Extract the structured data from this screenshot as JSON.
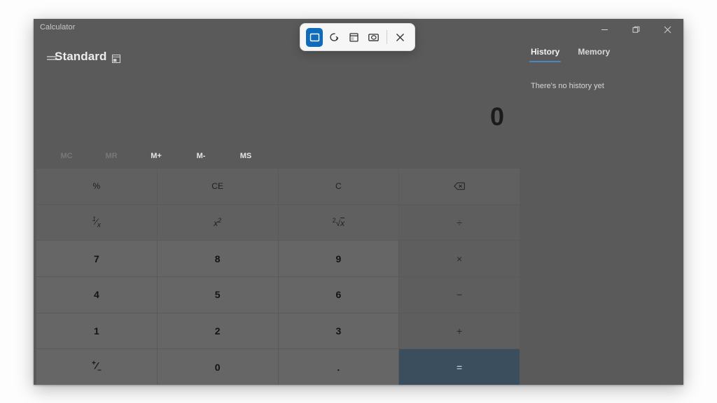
{
  "window": {
    "app_title": "Calculator",
    "controls": {
      "minimize": "minimize-icon",
      "restore": "restore-icon",
      "close": "close-icon"
    }
  },
  "header": {
    "menu_icon": "hamburger-menu-icon",
    "mode": "Standard",
    "keep_on_top_icon": "keep-on-top-icon"
  },
  "display": {
    "expression": "",
    "result": "0"
  },
  "memory": {
    "buttons": [
      {
        "label": "MC",
        "enabled": false
      },
      {
        "label": "MR",
        "enabled": false
      },
      {
        "label": "M+",
        "enabled": true
      },
      {
        "label": "M-",
        "enabled": true
      },
      {
        "label": "MS",
        "enabled": true
      }
    ]
  },
  "keypad": {
    "keys": [
      {
        "label": "%",
        "kind": "func",
        "name": "percent-button"
      },
      {
        "label": "CE",
        "kind": "func",
        "name": "clear-entry-button"
      },
      {
        "label": "C",
        "kind": "func",
        "name": "clear-button"
      },
      {
        "label": "",
        "kind": "func",
        "name": "backspace-button",
        "icon": "backspace-icon"
      },
      {
        "label": "",
        "kind": "func",
        "name": "reciprocal-button",
        "glyph": "reciprocal"
      },
      {
        "label": "",
        "kind": "func",
        "name": "square-button",
        "glyph": "square"
      },
      {
        "label": "",
        "kind": "func",
        "name": "square-root-button",
        "glyph": "sqrt"
      },
      {
        "label": "÷",
        "kind": "op",
        "name": "divide-button"
      },
      {
        "label": "7",
        "kind": "num",
        "name": "digit-7-button"
      },
      {
        "label": "8",
        "kind": "num",
        "name": "digit-8-button"
      },
      {
        "label": "9",
        "kind": "num",
        "name": "digit-9-button"
      },
      {
        "label": "×",
        "kind": "op",
        "name": "multiply-button"
      },
      {
        "label": "4",
        "kind": "num",
        "name": "digit-4-button"
      },
      {
        "label": "5",
        "kind": "num",
        "name": "digit-5-button"
      },
      {
        "label": "6",
        "kind": "num",
        "name": "digit-6-button"
      },
      {
        "label": "−",
        "kind": "op",
        "name": "subtract-button"
      },
      {
        "label": "1",
        "kind": "num",
        "name": "digit-1-button"
      },
      {
        "label": "2",
        "kind": "num",
        "name": "digit-2-button"
      },
      {
        "label": "3",
        "kind": "num",
        "name": "digit-3-button"
      },
      {
        "label": "+",
        "kind": "op",
        "name": "add-button"
      },
      {
        "label": "",
        "kind": "num",
        "name": "negate-button",
        "glyph": "negate"
      },
      {
        "label": "0",
        "kind": "num",
        "name": "digit-0-button"
      },
      {
        "label": ".",
        "kind": "num",
        "name": "decimal-button"
      },
      {
        "label": "=",
        "kind": "equals",
        "name": "equals-button"
      }
    ]
  },
  "side_panel": {
    "tabs": [
      {
        "label": "History",
        "active": true
      },
      {
        "label": "Memory",
        "active": false
      }
    ],
    "empty_message": "There's no history yet"
  },
  "snip_toolbar": {
    "buttons": [
      {
        "name": "rectangle-snip-icon",
        "selected": true
      },
      {
        "name": "freeform-snip-icon",
        "selected": false
      },
      {
        "name": "window-snip-icon",
        "selected": false
      },
      {
        "name": "fullscreen-snip-icon",
        "selected": false
      }
    ],
    "close_label": "close-icon"
  },
  "colors": {
    "accent": "#0f6cbd",
    "tab_underline": "#4b86c4",
    "equals": "#3b4e5d"
  }
}
